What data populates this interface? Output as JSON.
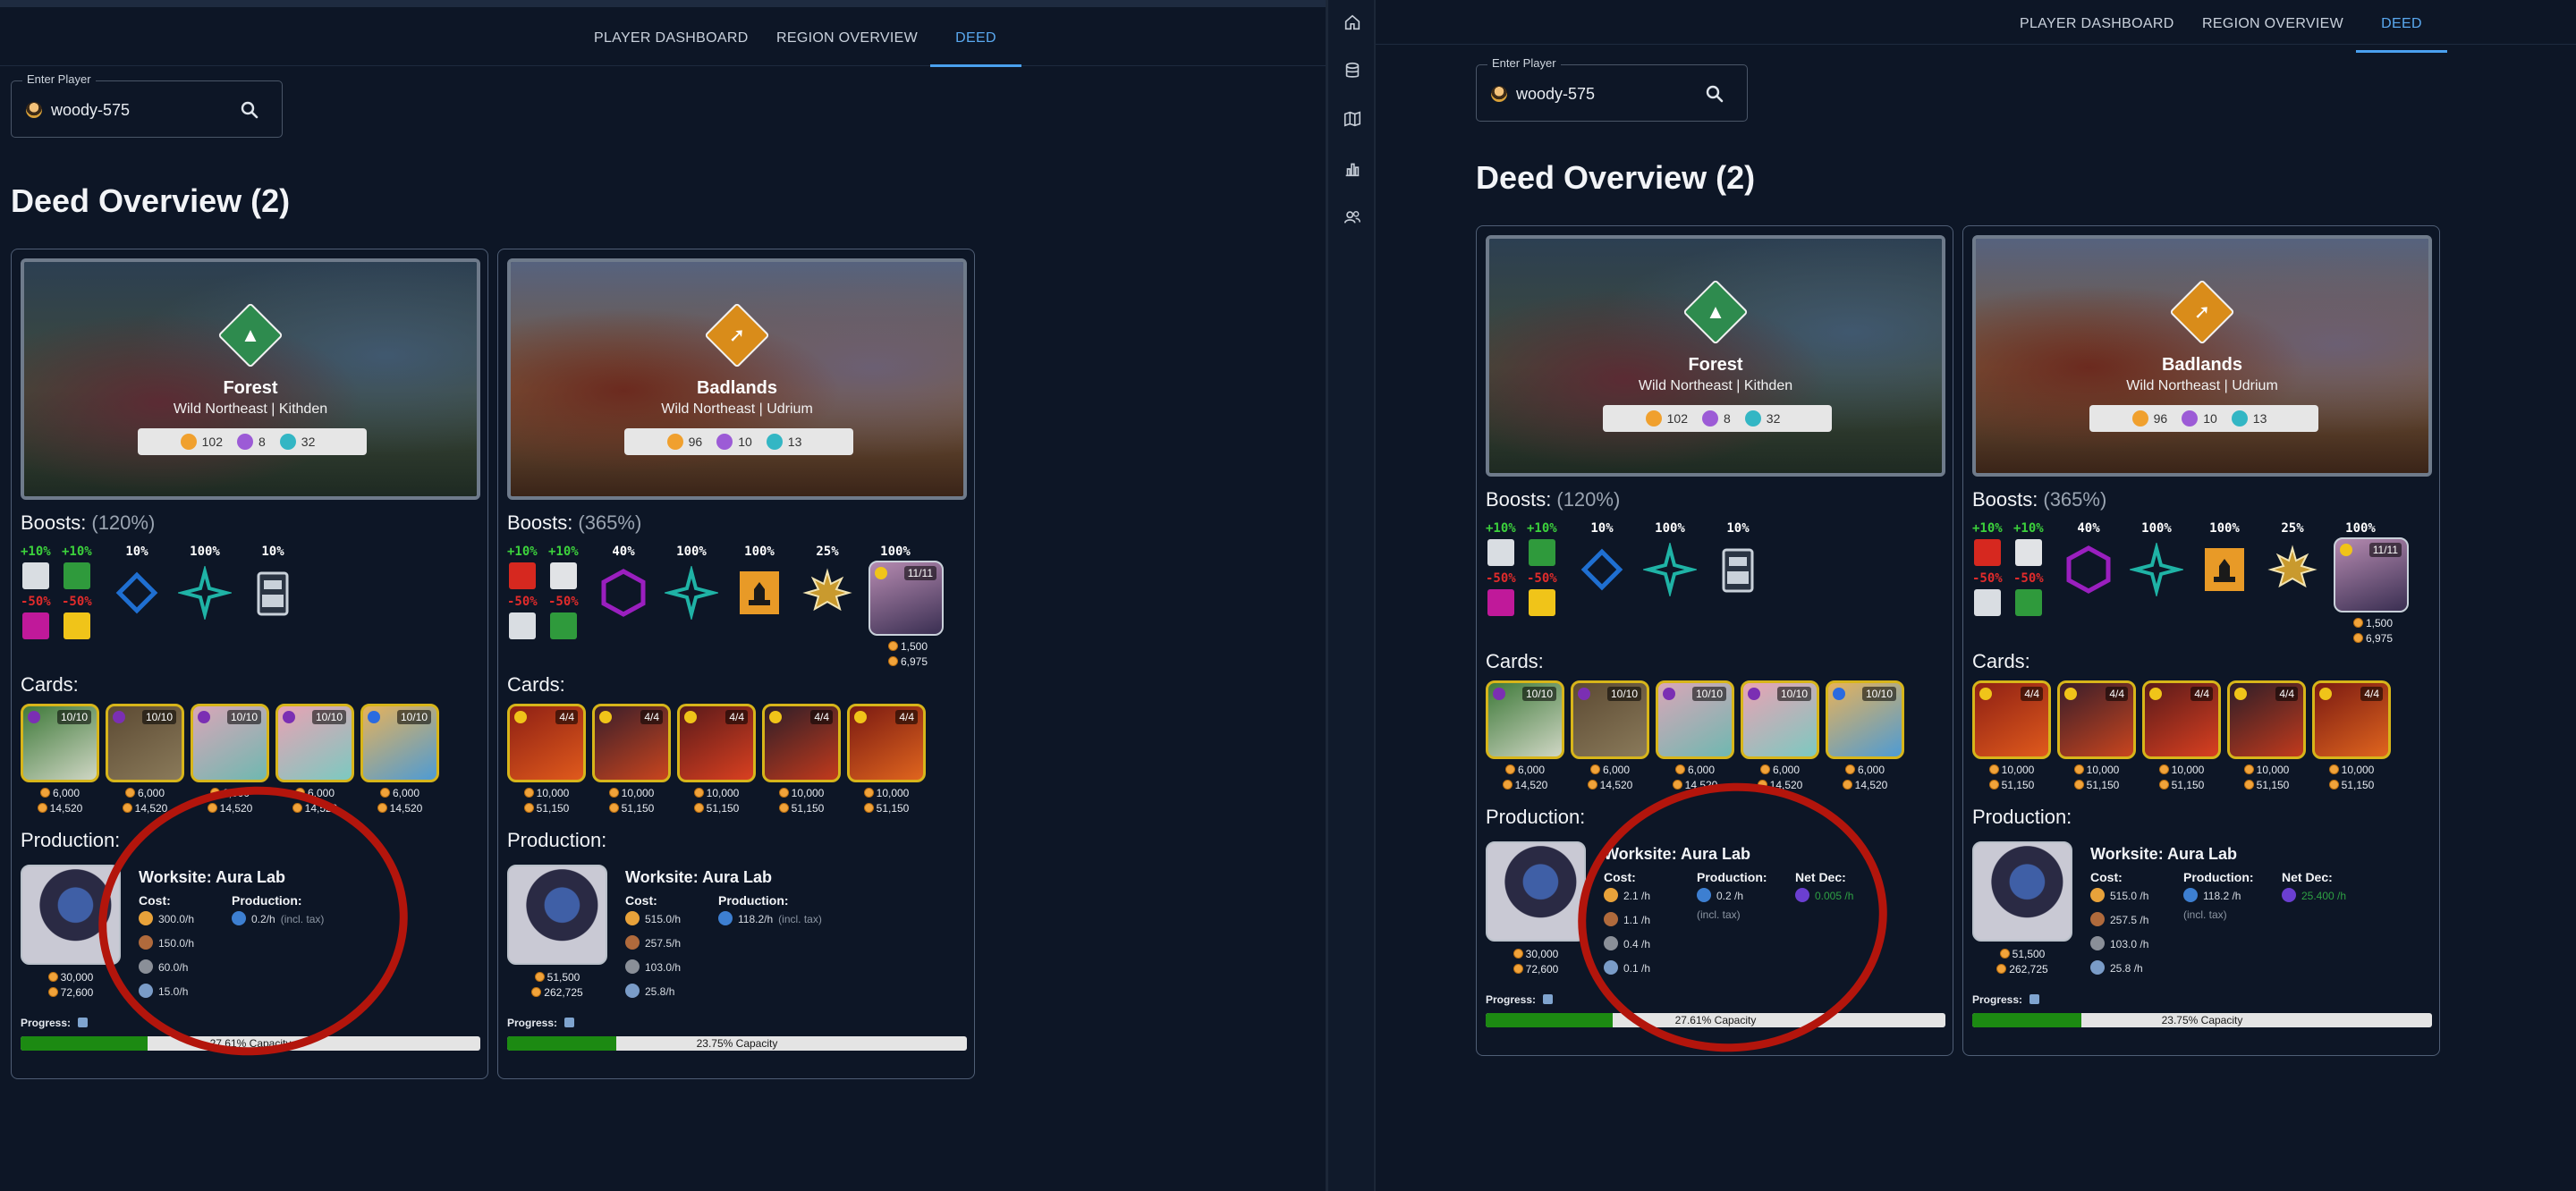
{
  "nav": {
    "items": [
      "PLAYER DASHBOARD",
      "REGION OVERVIEW",
      "DEED"
    ],
    "active": "DEED"
  },
  "player": {
    "label": "Enter Player",
    "value": "woody-575",
    "search_icon": "search-icon"
  },
  "overview_title": "Deed Overview (2)",
  "sidebar": {
    "icons": [
      "home-icon",
      "database-icon",
      "map-icon",
      "bar-chart-icon",
      "users-icon"
    ]
  },
  "deeds": [
    {
      "name": "Forest",
      "location": "Wild Northeast | Kithden",
      "stats": [
        "102",
        "8",
        "32"
      ],
      "emblem_color": "#2e8b4e",
      "boosts_label": "Boosts:",
      "boosts_pct": "(120%)",
      "boost_mods": {
        "plus": [
          "+10%",
          "+10%"
        ],
        "minus": [
          "-50%",
          "-50%"
        ]
      },
      "boost_values": [
        "10%",
        "100%",
        "10%"
      ],
      "boost_icons": [
        "diamond-icon",
        "star-icon",
        "totem-icon"
      ],
      "boost_extra": null,
      "cards_label": "Cards:",
      "cards": [
        {
          "level": "10/10",
          "power": "6,000",
          "dec": "14,520"
        },
        {
          "level": "10/10",
          "power": "6,000",
          "dec": "14,520"
        },
        {
          "level": "10/10",
          "power": "6,000",
          "dec": "14,520"
        },
        {
          "level": "10/10",
          "power": "6,000",
          "dec": "14,520"
        },
        {
          "level": "10/10",
          "power": "6,000",
          "dec": "14,520"
        }
      ],
      "production_label": "Production:",
      "worksite_title": "Worksite: Aura Lab",
      "ws_power": "30,000",
      "ws_dec": "72,600",
      "cost_header": "Cost:",
      "production_header": "Production:",
      "left_costs": [
        "300.0/h",
        "150.0/h",
        "60.0/h",
        "15.0/h"
      ],
      "right_costs": [
        "2.1 /h",
        "1.1 /h",
        "0.4 /h",
        "0.1 /h"
      ],
      "left_production": "0.2/h",
      "right_production": "0.2 /h",
      "tax_note": "(incl. tax)",
      "net_dec_header": "Net Dec:",
      "net_dec": "0.005 /h",
      "progress_label": "Progress:",
      "progress_pct": 27.61,
      "progress_text": "27.61% Capacity",
      "progress_text_left": "27.61% Capacity"
    },
    {
      "name": "Badlands",
      "location": "Wild Northeast | Udrium",
      "stats": [
        "96",
        "10",
        "13"
      ],
      "emblem_color": "#d98c1a",
      "boosts_label": "Boosts:",
      "boosts_pct": "(365%)",
      "boost_mods": {
        "plus": [
          "+10%",
          "+10%"
        ],
        "minus": [
          "-50%",
          "-50%"
        ]
      },
      "boost_values": [
        "40%",
        "100%",
        "100%",
        "25%",
        "100%"
      ],
      "boost_icons": [
        "hexagon-icon",
        "star-icon",
        "crown-icon",
        "sun-icon",
        "portrait-icon"
      ],
      "boost_extra": {
        "level": "11/11",
        "power": "1,500",
        "dec": "6,975"
      },
      "cards_label": "Cards:",
      "cards": [
        {
          "level": "4/4",
          "power": "10,000",
          "dec": "51,150"
        },
        {
          "level": "4/4",
          "power": "10,000",
          "dec": "51,150"
        },
        {
          "level": "4/4",
          "power": "10,000",
          "dec": "51,150"
        },
        {
          "level": "4/4",
          "power": "10,000",
          "dec": "51,150"
        },
        {
          "level": "4/4",
          "power": "10,000",
          "dec": "51,150"
        }
      ],
      "production_label": "Production:",
      "worksite_title": "Worksite: Aura Lab",
      "ws_power": "51,500",
      "ws_dec": "262,725",
      "cost_header": "Cost:",
      "production_header": "Production:",
      "left_costs": [
        "515.0/h",
        "257.5/h",
        "103.0/h",
        "25.8/h"
      ],
      "right_costs": [
        "515.0 /h",
        "257.5 /h",
        "103.0 /h",
        "25.8 /h"
      ],
      "left_production": "118.2/h",
      "right_production": "118.2 /h",
      "tax_note": "(incl. tax)",
      "net_dec_header": "Net Dec:",
      "net_dec": "25.400 /h",
      "progress_label": "Progress:",
      "progress_pct": 23.75,
      "progress_text": "23.75% Capacity",
      "progress_text_left": "23.75% Capacity"
    }
  ],
  "colors": {
    "bg": "#0d1626",
    "accent": "#4aa0ef",
    "progress_fill": "#1c8a12",
    "annotation": "#b3150c",
    "card_border": "#d7b51a"
  }
}
